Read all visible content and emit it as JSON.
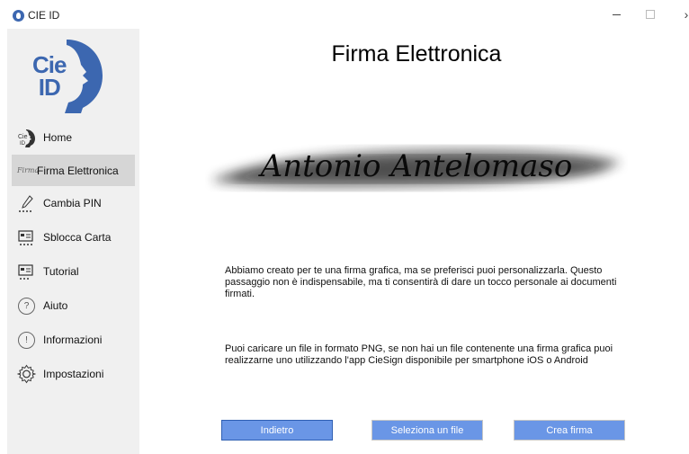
{
  "window": {
    "title": "CIE ID",
    "close_glyph": "›"
  },
  "logo": {
    "line1": "Cie",
    "line2": "ID"
  },
  "sidebar": {
    "items": [
      {
        "label": "Home",
        "icon": "cie-id-icon"
      },
      {
        "label": "Firma Elettronica",
        "icon": "signature-icon",
        "active": true
      },
      {
        "label": "Cambia PIN",
        "icon": "pen-pin-icon"
      },
      {
        "label": "Sblocca Carta",
        "icon": "card-unlock-icon"
      },
      {
        "label": "Tutorial",
        "icon": "tutorial-icon"
      },
      {
        "label": "Aiuto",
        "icon": "help-icon"
      },
      {
        "label": "Informazioni",
        "icon": "info-icon"
      },
      {
        "label": "Impostazioni",
        "icon": "gear-icon"
      }
    ],
    "icon_glyphs": {
      "help": "?",
      "info": "!",
      "signature": "Firma"
    }
  },
  "main": {
    "title": "Firma Elettronica",
    "signature_name": "Antonio Antelomaso",
    "paragraph1": "Abbiamo creato per te una firma grafica, ma se preferisci puoi personalizzarla. Questo passaggio non è indispensabile, ma ti consentirà di dare un tocco personale ai documenti firmati.",
    "paragraph2": "Puoi caricare un file in formato PNG, se non hai un file contenente una firma grafica puoi realizzarne uno utilizzando l'app CieSign disponibile per smartphone iOS o Android"
  },
  "buttons": {
    "back": "Indietro",
    "select_file": "Seleziona un file",
    "create_signature": "Crea firma"
  },
  "colors": {
    "accent": "#3c67b0",
    "button": "#6a96e6",
    "sidebar_bg": "#f0f0f0",
    "active_item": "#d6d6d6"
  }
}
